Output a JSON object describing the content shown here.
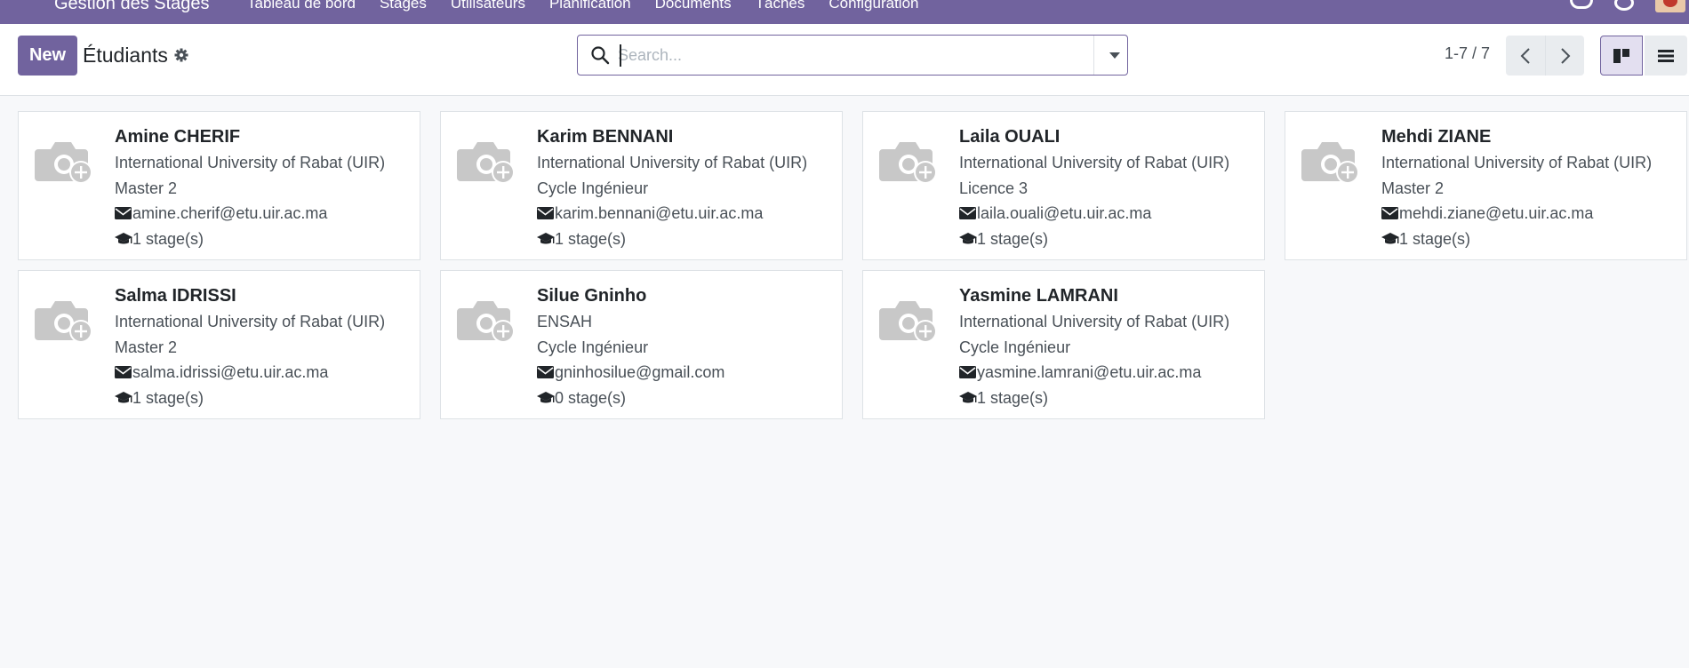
{
  "navbar": {
    "brand": "Gestion des Stages",
    "menu": [
      "Tableau de bord",
      "Stages",
      "Utilisateurs",
      "Planification",
      "Documents",
      "Tâches",
      "Configuration"
    ]
  },
  "control": {
    "new_label": "New",
    "title": "Étudiants",
    "search_placeholder": "Search...",
    "pager": "1-7 / 7"
  },
  "students": [
    {
      "name": "Amine CHERIF",
      "school": "International University of Rabat (UIR)",
      "level": "Master 2",
      "email": "amine.cherif@etu.uir.ac.ma",
      "stages": "1 stage(s)"
    },
    {
      "name": "Karim BENNANI",
      "school": "International University of Rabat (UIR)",
      "level": "Cycle Ingénieur",
      "email": "karim.bennani@etu.uir.ac.ma",
      "stages": "1 stage(s)"
    },
    {
      "name": "Laila OUALI",
      "school": "International University of Rabat (UIR)",
      "level": "Licence 3",
      "email": "laila.ouali@etu.uir.ac.ma",
      "stages": "1 stage(s)"
    },
    {
      "name": "Mehdi ZIANE",
      "school": "International University of Rabat (UIR)",
      "level": "Master 2",
      "email": "mehdi.ziane@etu.uir.ac.ma",
      "stages": "1 stage(s)"
    },
    {
      "name": "Salma IDRISSI",
      "school": "International University of Rabat (UIR)",
      "level": "Master 2",
      "email": "salma.idrissi@etu.uir.ac.ma",
      "stages": "1 stage(s)"
    },
    {
      "name": "Silue Gninho",
      "school": "ENSAH",
      "level": "Cycle Ingénieur",
      "email": "gninhosilue@gmail.com",
      "stages": "0 stage(s)"
    },
    {
      "name": "Yasmine LAMRANI",
      "school": "International University of Rabat (UIR)",
      "level": "Cycle Ingénieur",
      "email": "yasmine.lamrani@etu.uir.ac.ma",
      "stages": "1 stage(s)"
    }
  ],
  "icons": {
    "apps": "apps-grid-icon",
    "gear": "gear-icon",
    "search": "search-icon",
    "email": "envelope-icon",
    "stage": "graduation-cap-icon",
    "avatar": "camera-add-icon"
  },
  "colors": {
    "brand": "#71639e",
    "background": "#f7f8fa"
  }
}
